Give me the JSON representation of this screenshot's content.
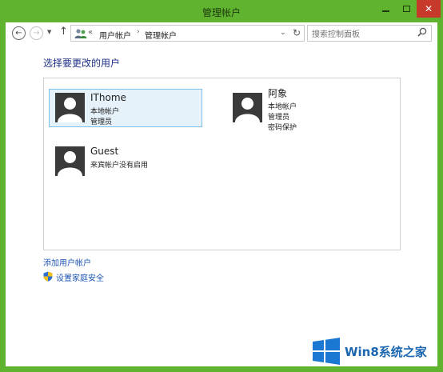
{
  "window": {
    "title": "管理帐户",
    "close_glyph": "✕"
  },
  "toolbar": {
    "back_glyph": "←",
    "forward_glyph": "→",
    "recent_glyph": "▼",
    "up_glyph": "↑",
    "breadcrumb_separator": "«",
    "breadcrumb": [
      "用户帐户",
      "管理帐户"
    ],
    "breadcrumb_arrow": "›",
    "dropdown_glyph": "⌄",
    "refresh_glyph": "↻",
    "search_placeholder": "搜索控制面板"
  },
  "main": {
    "heading": "选择要更改的用户",
    "accounts": [
      {
        "name": "IThome",
        "lines": [
          "本地帐户",
          "管理员"
        ],
        "selected": true
      },
      {
        "name": "阿象",
        "lines": [
          "本地帐户",
          "管理员",
          "密码保护"
        ],
        "selected": false
      },
      {
        "name": "Guest",
        "lines": [
          "来宾帐户没有启用"
        ],
        "selected": false
      }
    ],
    "links": {
      "add_user": "添加用户帐户",
      "family_safety": "设置家庭安全"
    }
  },
  "watermark": {
    "text": "Win8系统之家"
  },
  "colors": {
    "frame": "#5fb32e",
    "close_button": "#c7392b",
    "heading": "#1e3287",
    "link": "#1e56b4",
    "selection_fill": "#e6f2fa",
    "selection_border": "#7fc1ea",
    "avatar": "#3a3a3a"
  }
}
